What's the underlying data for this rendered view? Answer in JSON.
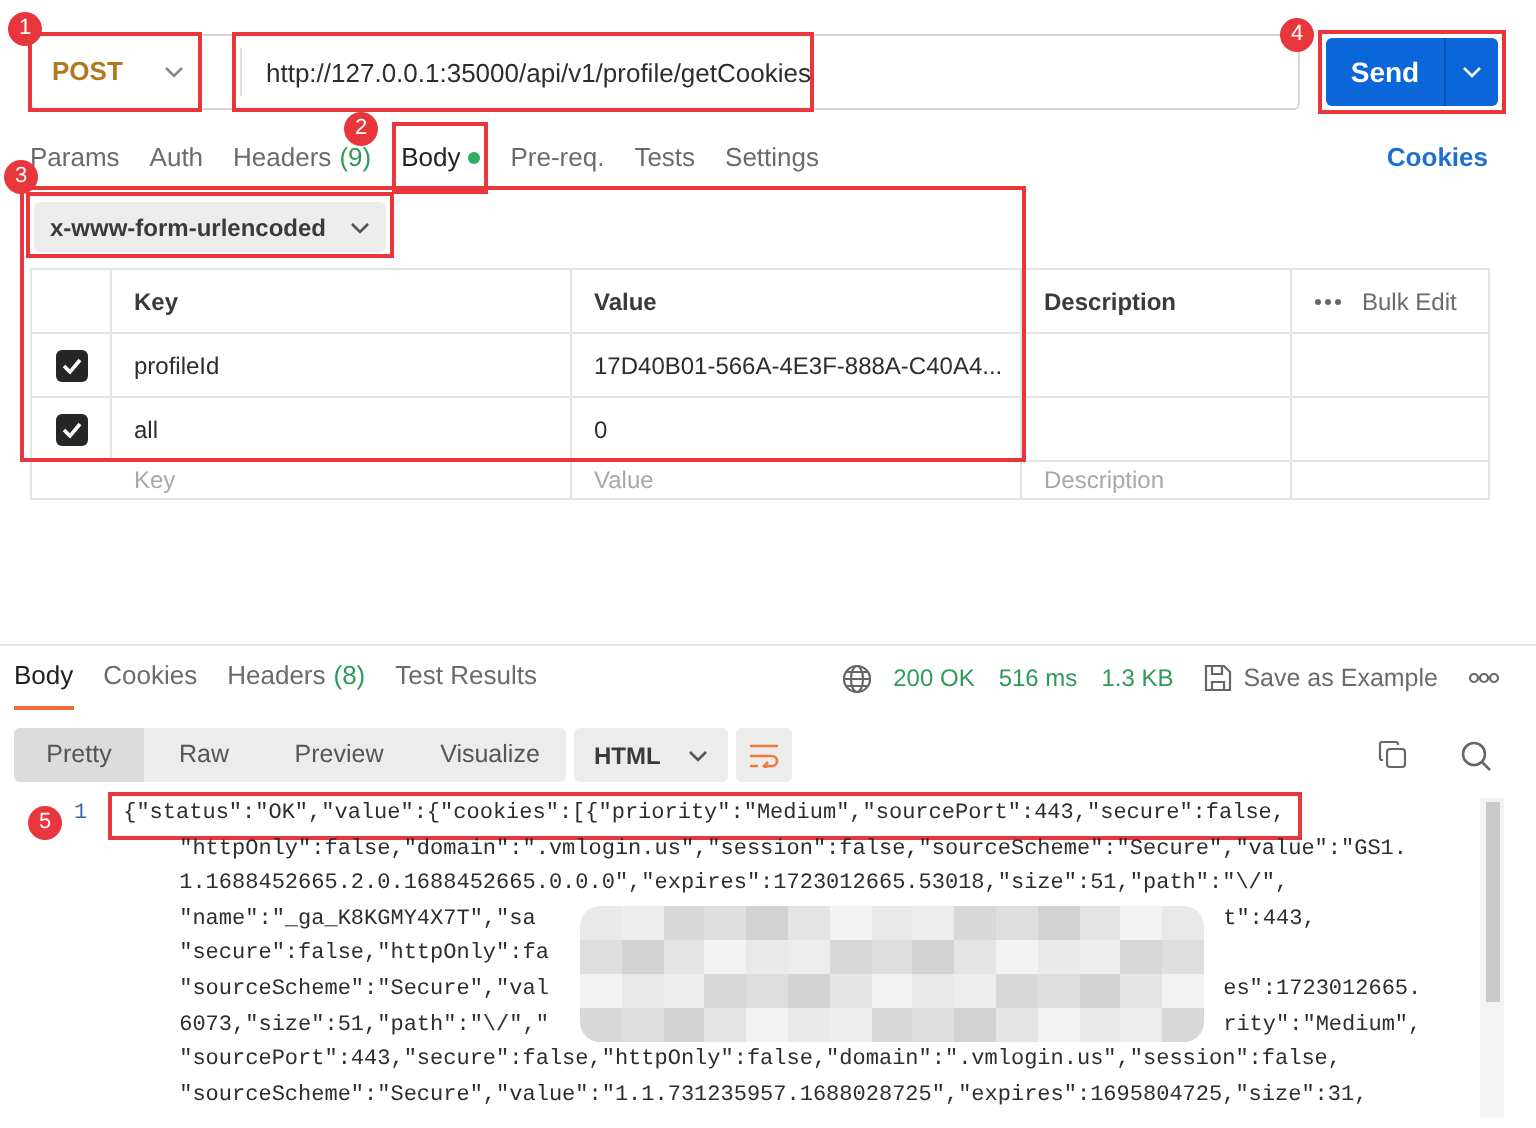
{
  "request": {
    "method": "POST",
    "url": "http://127.0.0.1:35000/api/v1/profile/getCookies",
    "send_label": "Send"
  },
  "request_tabs": [
    {
      "label": "Params",
      "selected": false,
      "dot": false
    },
    {
      "label": "Auth",
      "selected": false,
      "dot": false
    },
    {
      "label": "Headers",
      "count": "(9)",
      "selected": false,
      "dot": false
    },
    {
      "label": "Body",
      "selected": true,
      "dot": true
    },
    {
      "label": "Pre-req.",
      "selected": false,
      "dot": false
    },
    {
      "label": "Tests",
      "selected": false,
      "dot": false
    },
    {
      "label": "Settings",
      "selected": false,
      "dot": false
    }
  ],
  "cookies_link": "Cookies",
  "body_type": "x-www-form-urlencoded",
  "params_table": {
    "columns": [
      "Key",
      "Value",
      "Description"
    ],
    "bulk_edit": "Bulk Edit",
    "rows": [
      {
        "checked": true,
        "key": "profileId",
        "value": "17D40B01-566A-4E3F-888A-C40A4..."
      },
      {
        "checked": true,
        "key": "all",
        "value": "0"
      }
    ],
    "placeholder_row": [
      {
        "placeholder": "Key"
      },
      {
        "placeholder": "Value"
      },
      {
        "placeholder": "Description"
      }
    ]
  },
  "response": {
    "tabs": [
      {
        "label": "Body",
        "selected": true
      },
      {
        "label": "Cookies",
        "selected": false
      },
      {
        "label": "Headers",
        "count": "(8)",
        "selected": false
      },
      {
        "label": "Test Results",
        "selected": false
      }
    ],
    "status": "200 OK",
    "time": "516 ms",
    "size": "1.3 KB",
    "save_label": "Save as Example",
    "formats": [
      {
        "label": "Pretty",
        "selected": true
      },
      {
        "label": "Raw",
        "selected": false
      },
      {
        "label": "Preview",
        "selected": false
      },
      {
        "label": "Visualize",
        "selected": false
      }
    ],
    "language": "HTML",
    "line_wrap": true,
    "code": {
      "line_number": "1",
      "rows": [
        {
          "kind": "text",
          "text": "{\"status\":\"OK\",\"value\":{\"cookies\":[{\"priority\":\"Medium\",\"sourcePort\":443,\"secure\":false,"
        },
        {
          "kind": "text",
          "text": "\"httpOnly\":false,\"domain\":\".vmlogin.us\",\"session\":false,\"sourceScheme\":\"Secure\",\"value\":\"GS1."
        },
        {
          "kind": "text",
          "text": "1.1688452665.2.0.1688452665.0.0.0\",\"expires\":1723012665.53018,\"size\":51,\"path\":\"\\/\","
        },
        {
          "kind": "redacted",
          "left": "\"name\":\"_ga_K8KGMY4X7T\",\"sa",
          "right": "t\":443,"
        },
        {
          "kind": "redacted",
          "left": "\"secure\":false,\"httpOnly\":fa",
          "right": ""
        },
        {
          "kind": "redacted",
          "left": "\"sourceScheme\":\"Secure\",\"val",
          "right": "es\":1723012665."
        },
        {
          "kind": "redacted",
          "left": "6073,\"size\":51,\"path\":\"\\/\",\"",
          "right": "rity\":\"Medium\","
        },
        {
          "kind": "text",
          "text": "\"sourcePort\":443,\"secure\":false,\"httpOnly\":false,\"domain\":\".vmlogin.us\",\"session\":false,"
        },
        {
          "kind": "text",
          "text": "\"sourceScheme\":\"Secure\",\"value\":\"1.1.731235957.1688028725\",\"expires\":1695804725,\"size\":31,"
        }
      ]
    }
  },
  "annotations": [
    {
      "label": "1"
    },
    {
      "label": "2"
    },
    {
      "label": "3"
    },
    {
      "label": "4"
    },
    {
      "label": "5"
    }
  ]
}
